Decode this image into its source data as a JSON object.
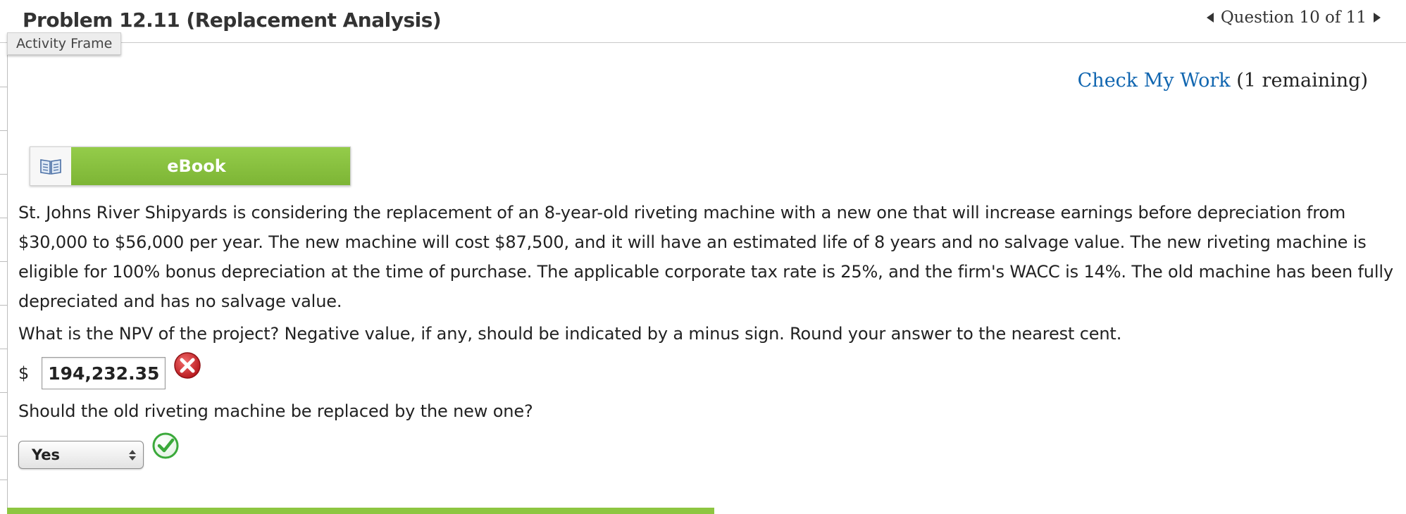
{
  "header": {
    "title": "Problem 12.11 (Replacement Analysis)",
    "question_nav": "Question 10 of 11"
  },
  "tooltip": {
    "activity_frame": "Activity Frame"
  },
  "check_work": {
    "link_label": "Check My Work",
    "remaining": "(1 remaining)"
  },
  "ebook": {
    "label": "eBook",
    "icon": "book-icon",
    "color": "#8dc641"
  },
  "problem": {
    "text": "St. Johns River Shipyards is considering the replacement of an 8-year-old riveting machine with a new one that will increase earnings before depreciation from $30,000 to $56,000 per year. The new machine will cost $87,500, and it will have an estimated life of 8 years and no salvage value. The new riveting machine is eligible for 100% bonus depreciation at the time of purchase. The applicable corporate tax rate is 25%, and the firm's WACC is 14%. The old machine has been fully depreciated and has no salvage value."
  },
  "question1": {
    "text": "What is the NPV of the project? Negative value, if any, should be indicated by a minus sign. Round your answer to the nearest cent.",
    "currency": "$",
    "answer": "194,232.35",
    "status": "incorrect",
    "status_icon": "incorrect-x-icon",
    "status_color": "#d0262b"
  },
  "question2": {
    "text": "Should the old riveting machine be replaced by the new one?",
    "selected": "Yes",
    "status": "correct",
    "status_icon": "correct-check-icon",
    "status_color": "#3aa93a"
  }
}
